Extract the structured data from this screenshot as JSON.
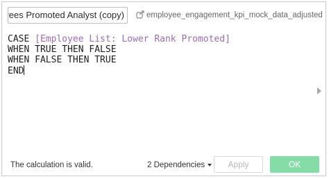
{
  "calculation": {
    "name": "Employees Promoted Analyst (copy)",
    "name_visible": "nployees Promoted Analyst (copy)",
    "datasource_icon": "datasource-link-icon",
    "datasource_name": "employee_engagement_kpi_mock_data_adjusted"
  },
  "formula": {
    "keyword_case": "CASE",
    "field_reference": "[Employee List: Lower Rank Promoted]",
    "line2": "WHEN TRUE THEN FALSE",
    "line3": "WHEN FALSE THEN TRUE",
    "line4": "END"
  },
  "footer": {
    "status_text": "The calculation is valid.",
    "dependencies_label": "2 Dependencies",
    "apply_label": "Apply",
    "ok_label": "OK"
  },
  "colors": {
    "field_reference": "#9c6bb8",
    "ok_button": "#86dca7",
    "apply_disabled_text": "#b7b7b7"
  }
}
